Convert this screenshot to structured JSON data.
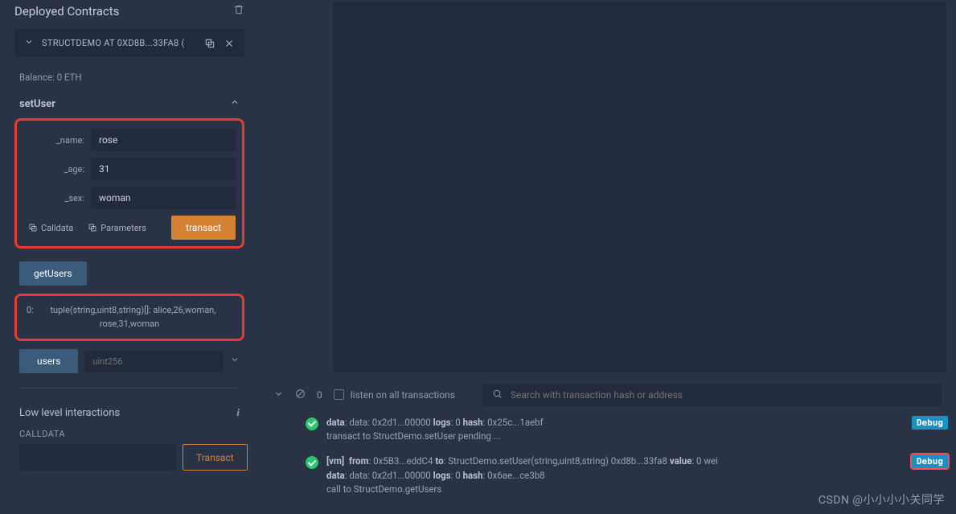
{
  "panel": {
    "title": "Deployed Contracts",
    "contract_label": "STRUCTDEMO AT 0XD8B...33FA8 (",
    "balance": "Balance: 0 ETH"
  },
  "setUser": {
    "title": "setUser",
    "name_label": "_name:",
    "name_value": "rose",
    "age_label": "_age:",
    "age_value": "31",
    "sex_label": "_sex:",
    "sex_value": "woman",
    "calldata_btn": "Calldata",
    "parameters_btn": "Parameters",
    "transact_btn": "transact"
  },
  "getUsers": {
    "btn": "getUsers",
    "result_idx": "0:",
    "result_text": "tuple(string,uint8,string)[]: alice,26,woman, rose,31,woman"
  },
  "users": {
    "btn": "users",
    "placeholder": "uint256"
  },
  "lowlevel": {
    "title": "Low level interactions",
    "calldata": "CALLDATA",
    "transact": "Transact"
  },
  "console": {
    "count": "0",
    "listen": "listen on all transactions",
    "search_placeholder": "Search with transaction hash or address",
    "debug": "Debug"
  },
  "logs": {
    "l1a": "data: 0x2d1...00000 logs: 0 hash: 0x25c...1aebf",
    "l1b": "transact to StructDemo.setUser pending ...",
    "l2a": "[vm]  from: 0x5B3...eddC4 to: StructDemo.setUser(string,uint8,string) 0xd8b...33fa8 value: 0 wei",
    "l2b": "data: 0x2d1...00000 logs: 0 hash: 0x6ae...ce3b8",
    "l2c": "call to StructDemo.getUsers"
  },
  "watermark": "CSDN @小小小小关同学"
}
